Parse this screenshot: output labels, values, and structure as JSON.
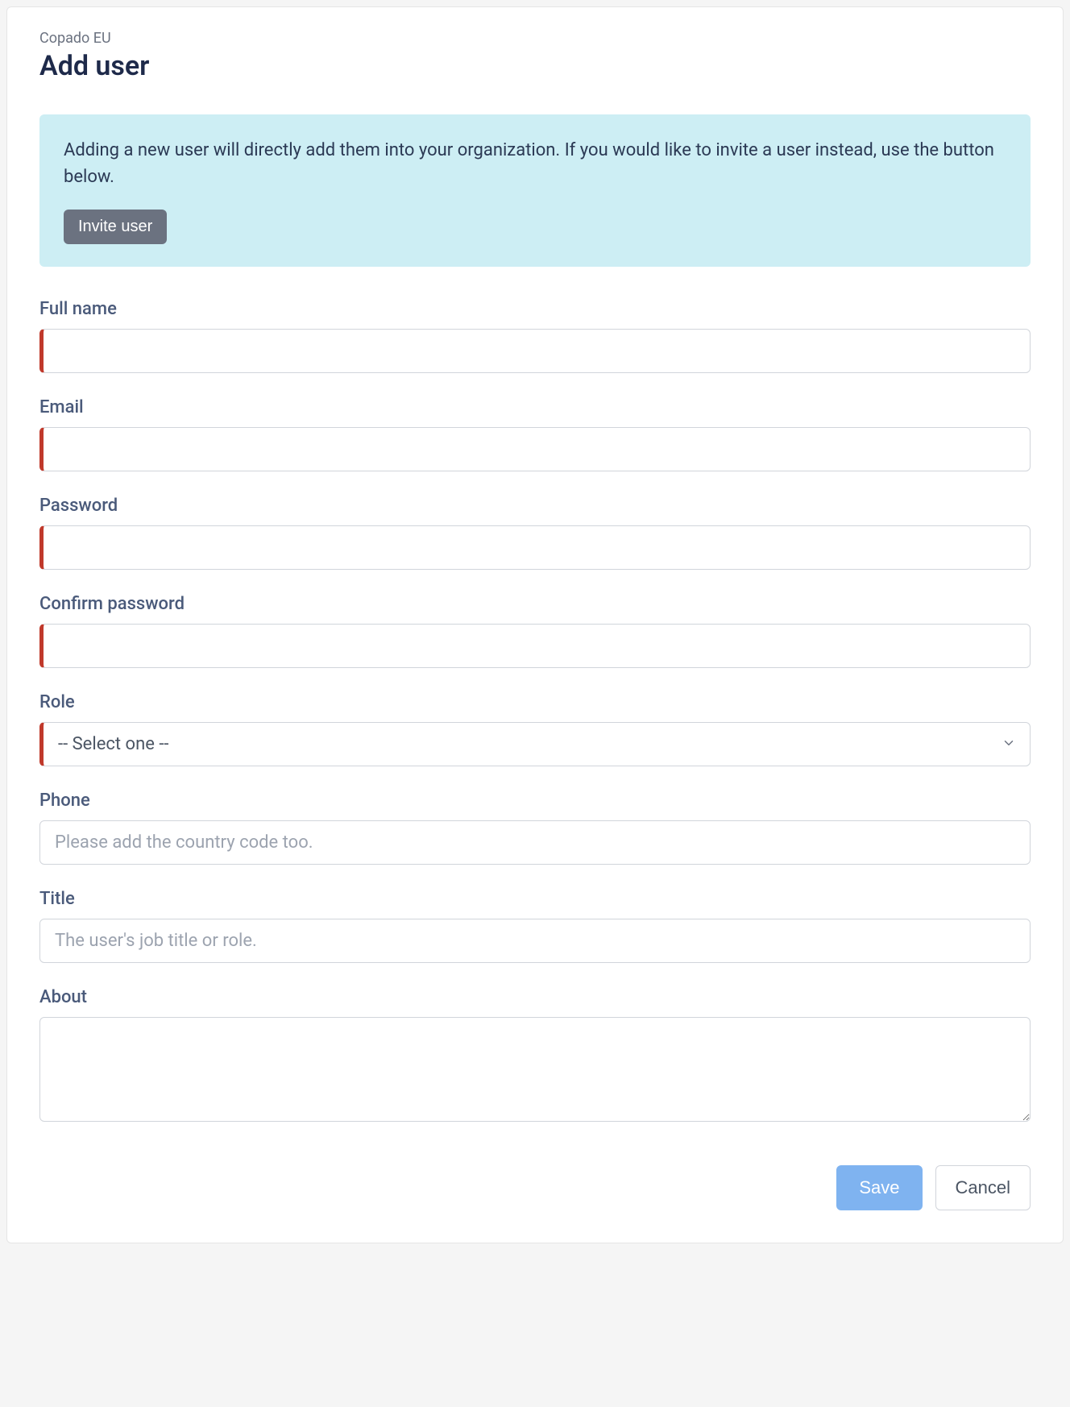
{
  "breadcrumb": "Copado EU",
  "title": "Add user",
  "info": {
    "text": "Adding a new user will directly add them into your organization. If you would like to invite a user instead, use the button below.",
    "invite_label": "Invite user"
  },
  "fields": {
    "full_name": {
      "label": "Full name",
      "value": ""
    },
    "email": {
      "label": "Email",
      "value": ""
    },
    "password": {
      "label": "Password",
      "value": ""
    },
    "confirm_password": {
      "label": "Confirm password",
      "value": ""
    },
    "role": {
      "label": "Role",
      "selected": "-- Select one --"
    },
    "phone": {
      "label": "Phone",
      "value": "",
      "placeholder": "Please add the country code too."
    },
    "title": {
      "label": "Title",
      "value": "",
      "placeholder": "The user's job title or role."
    },
    "about": {
      "label": "About",
      "value": ""
    }
  },
  "actions": {
    "save": "Save",
    "cancel": "Cancel"
  }
}
